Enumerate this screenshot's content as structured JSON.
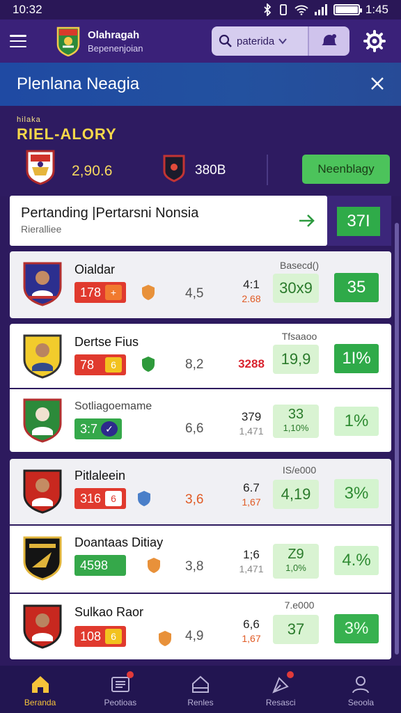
{
  "status": {
    "time_left": "10:32",
    "time_right": "1:45"
  },
  "header": {
    "app_name": "Olahragah",
    "app_sub": "Bepenenjoian",
    "search_label": "paterida",
    "colors": {
      "bar": "#3a2179",
      "accent": "#f7d84a",
      "green": "#2faa49"
    }
  },
  "banner": {
    "title": "Plenlana Neagia"
  },
  "league": {
    "small_label": "hilaka",
    "title": "RIEL-ALORY",
    "team_a_score": "2,90.6",
    "team_b_score": "380B",
    "follow_label": "Neenblagy"
  },
  "match": {
    "title": "Pertanding |Pertarsni Nonsia",
    "subtitle": "Rieralliee",
    "score": "37I"
  },
  "players": [
    {
      "name": "Oialdar",
      "badge": "178",
      "badge_tag": "+",
      "avg": "4,5",
      "mid_top": "4:1",
      "mid_bottom": "2.68",
      "head": "Basecd()",
      "box": "30x9",
      "box_sub": "",
      "rating": "35"
    },
    {
      "name": "Dertse Fius",
      "badge": "78",
      "badge_tag": "6",
      "avg": "8,2",
      "mid_top": "3288",
      "mid_bottom": "",
      "head": "Tfsaaoo",
      "box": "19,9",
      "box_sub": "",
      "rating": "1I%"
    },
    {
      "name": "Sotliagoemame",
      "badge": "3:7",
      "badge_tag": "✓",
      "avg": "6,6",
      "mid_top": "379",
      "mid_bottom": "1,471",
      "head": "",
      "box": "33",
      "box_sub": "1,10%",
      "rating": "1%"
    },
    {
      "name": "Pitlaleein",
      "badge": "316",
      "badge_tag": "6",
      "avg": "3,6",
      "mid_top": "6.7",
      "mid_bottom": "1,67",
      "head": "IS/e000",
      "box": "4,19",
      "box_sub": "",
      "rating": "3%"
    },
    {
      "name": "Doantaas Ditiay",
      "badge": "4598",
      "badge_tag": "",
      "avg": "3,8",
      "mid_top": "1;6",
      "mid_bottom": "1,471",
      "head": "",
      "box": "Z9",
      "box_sub": "1,0%",
      "rating": "4.%"
    },
    {
      "name": "Sulkao Raor",
      "badge": "108",
      "badge_tag": "6",
      "avg": "4,9",
      "mid_top": "6,6",
      "mid_bottom": "1,67",
      "head": "7.e000",
      "box": "37",
      "box_sub": "",
      "rating": "3%"
    }
  ],
  "nav": [
    {
      "label": "Beranda"
    },
    {
      "label": "Peotioas"
    },
    {
      "label": "Renles"
    },
    {
      "label": "Resasci"
    },
    {
      "label": "Seoola"
    }
  ]
}
